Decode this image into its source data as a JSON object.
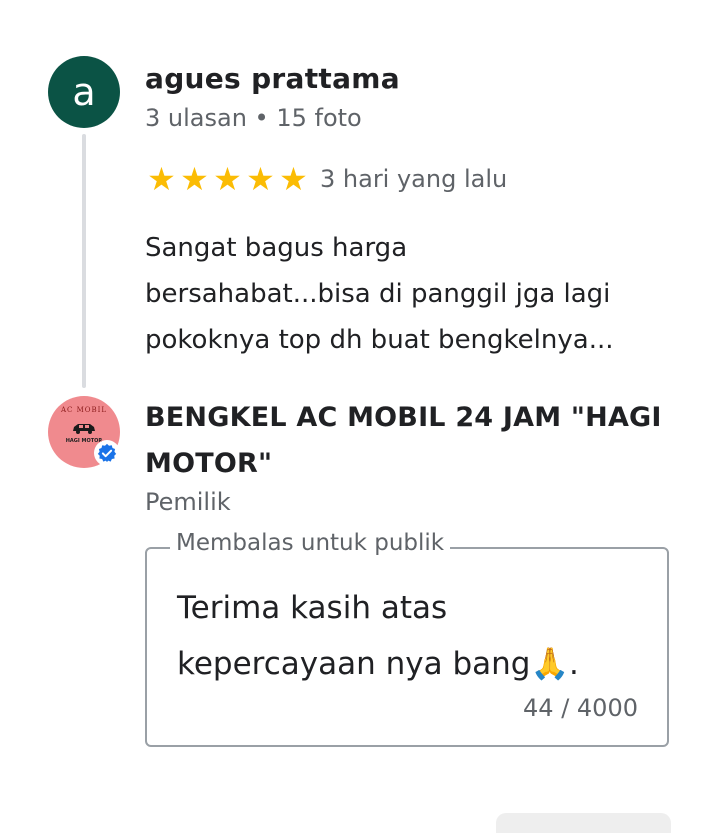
{
  "reviewer": {
    "avatar_letter": "a",
    "name": "agues prattama",
    "meta": "3 ulasan • 15 foto",
    "rating": 5,
    "stars": [
      "★",
      "★",
      "★",
      "★",
      "★"
    ],
    "date": "3 hari yang lalu",
    "text_lines": [
      "Sangat bagus harga",
      "bersahabat...bisa di panggil jga lagi",
      "pokoknya top dh buat bengkelnya..."
    ]
  },
  "owner": {
    "logo_top_text": "AC MOBIL",
    "logo_mid_text": "HAGI MOTOR",
    "name_lines": [
      "BENGKEL AC MOBIL 24 JAM \"HAGI",
      "MOTOR\""
    ],
    "role": "Pemilik",
    "reply_legend": "Membalas untuk publik",
    "reply_lines": [
      "Terima kasih atas",
      "kepercayaan nya bang🙏."
    ],
    "char_count": "44 / 4000"
  },
  "icons": {
    "verified": "verified-badge-icon",
    "star": "star-icon"
  },
  "colors": {
    "avatar_user_bg": "#0b5345",
    "avatar_owner_bg": "#f08a8e",
    "star": "#fbbc04",
    "verified": "#1a73e8",
    "secondary_text": "#5f6368"
  }
}
